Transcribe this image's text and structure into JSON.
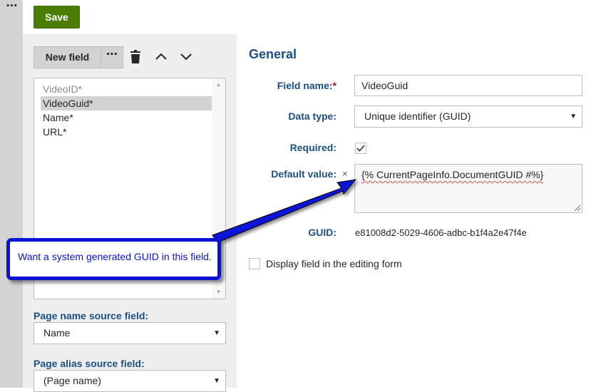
{
  "toolbar": {
    "save_label": "Save"
  },
  "rail": {
    "menu_label": "⋯"
  },
  "field_panel": {
    "new_field_label": "New field",
    "more_label": "⋯",
    "fields": [
      {
        "label": "VideoID*",
        "state": "disabled"
      },
      {
        "label": "VideoGuid*",
        "state": "selected"
      },
      {
        "label": "Name*",
        "state": "normal"
      },
      {
        "label": "URL*",
        "state": "normal"
      }
    ],
    "page_name_source_label": "Page name source field:",
    "page_name_source_value": "Name",
    "page_alias_source_label": "Page alias source field:",
    "page_alias_source_value": "(Page name)"
  },
  "form": {
    "section_title": "General",
    "field_name_label": "Field name:",
    "required_star": "*",
    "field_name_value": "VideoGuid",
    "data_type_label": "Data type:",
    "data_type_value": "Unique identifier (GUID)",
    "required_label": "Required:",
    "required_checked": true,
    "default_value_label": "Default value:",
    "default_value_clear": "×",
    "default_value_text": "{% CurrentPageInfo.DocumentGUID #%}",
    "guid_label": "GUID:",
    "guid_value": "e81008d2-5029-4606-adbc-b1f4a2e47f4e",
    "display_field_label": "Display field in the editing form",
    "display_field_checked": false
  },
  "annotation": {
    "callout_text": "Want a system generated GUID in this field."
  },
  "colors": {
    "save_green": "#497d04",
    "label_blue": "#1c4f82",
    "callout_blue": "#0a12d6",
    "selected_row": "#d2d2d2",
    "panel_gray": "#eeeeee"
  },
  "icons": {
    "delete": "trash-icon",
    "move_up": "chevron-up-icon",
    "move_down": "chevron-down-icon",
    "select_caret": "caret-down-icon"
  }
}
